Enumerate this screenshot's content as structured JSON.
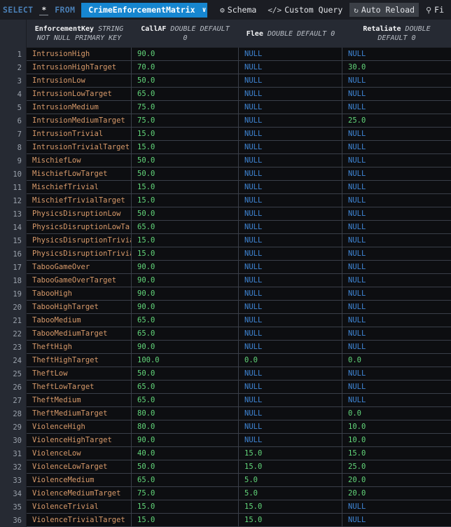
{
  "toolbar": {
    "select_keyword": "SELECT",
    "star": "*",
    "from_keyword": "FROM",
    "table_name": "CrimeEnforcementMatrix",
    "chevron": "∨",
    "schema_icon": "⚙",
    "schema_label": "Schema",
    "custom_query_icon": "</>",
    "custom_query_label": "Custom Query",
    "auto_reload_icon": "↻",
    "auto_reload_label": "Auto Reload",
    "find_icon": "⚲",
    "find_label": "Fi",
    "accent_blue": "#1686d0",
    "keyword_blue": "#4a7fb5",
    "button_fill": "#3b3f46"
  },
  "grid": {
    "columns": [
      {
        "name": "EnforcementKey",
        "type_line1": "STRING",
        "type_line2": "NOT NULL PRIMARY KEY"
      },
      {
        "name": "CallAF",
        "type_line1": "DOUBLE DEFAULT",
        "type_line2": "0"
      },
      {
        "name": "Flee",
        "type_line1": "DOUBLE DEFAULT 0",
        "type_line2": ""
      },
      {
        "name": "Retaliate",
        "type_line1": "DOUBLE",
        "type_line2": "DEFAULT 0"
      }
    ],
    "null_text": "NULL",
    "key_color": "#d89a6a",
    "number_color": "#62d67a",
    "null_color": "#3f86d6",
    "rows": [
      {
        "n": "1",
        "key": "IntrusionHigh",
        "callaf": "90.0",
        "flee": "NULL",
        "retaliate": "NULL"
      },
      {
        "n": "2",
        "key": "IntrusionHighTarget",
        "callaf": "70.0",
        "flee": "NULL",
        "retaliate": "30.0"
      },
      {
        "n": "3",
        "key": "IntrusionLow",
        "callaf": "50.0",
        "flee": "NULL",
        "retaliate": "NULL"
      },
      {
        "n": "4",
        "key": "IntrusionLowTarget",
        "callaf": "65.0",
        "flee": "NULL",
        "retaliate": "NULL"
      },
      {
        "n": "5",
        "key": "IntrusionMedium",
        "callaf": "75.0",
        "flee": "NULL",
        "retaliate": "NULL"
      },
      {
        "n": "6",
        "key": "IntrusionMediumTarget",
        "callaf": "75.0",
        "flee": "NULL",
        "retaliate": "25.0"
      },
      {
        "n": "7",
        "key": "IntrusionTrivial",
        "callaf": "15.0",
        "flee": "NULL",
        "retaliate": "NULL"
      },
      {
        "n": "8",
        "key": "IntrusionTrivialTarget",
        "callaf": "15.0",
        "flee": "NULL",
        "retaliate": "NULL"
      },
      {
        "n": "9",
        "key": "MischiefLow",
        "callaf": "50.0",
        "flee": "NULL",
        "retaliate": "NULL"
      },
      {
        "n": "10",
        "key": "MischiefLowTarget",
        "callaf": "50.0",
        "flee": "NULL",
        "retaliate": "NULL"
      },
      {
        "n": "11",
        "key": "MischiefTrivial",
        "callaf": "15.0",
        "flee": "NULL",
        "retaliate": "NULL"
      },
      {
        "n": "12",
        "key": "MischiefTrivialTarget",
        "callaf": "15.0",
        "flee": "NULL",
        "retaliate": "NULL"
      },
      {
        "n": "13",
        "key": "PhysicsDisruptionLow",
        "callaf": "50.0",
        "flee": "NULL",
        "retaliate": "NULL"
      },
      {
        "n": "14",
        "key": "PhysicsDisruptionLowTarget",
        "callaf": "65.0",
        "flee": "NULL",
        "retaliate": "NULL"
      },
      {
        "n": "15",
        "key": "PhysicsDisruptionTrivial",
        "callaf": "15.0",
        "flee": "NULL",
        "retaliate": "NULL"
      },
      {
        "n": "16",
        "key": "PhysicsDisruptionTrivialTarget",
        "callaf": "15.0",
        "flee": "NULL",
        "retaliate": "NULL"
      },
      {
        "n": "17",
        "key": "TabooGameOver",
        "callaf": "90.0",
        "flee": "NULL",
        "retaliate": "NULL"
      },
      {
        "n": "18",
        "key": "TabooGameOverTarget",
        "callaf": "90.0",
        "flee": "NULL",
        "retaliate": "NULL"
      },
      {
        "n": "19",
        "key": "TabooHigh",
        "callaf": "90.0",
        "flee": "NULL",
        "retaliate": "NULL"
      },
      {
        "n": "20",
        "key": "TabooHighTarget",
        "callaf": "90.0",
        "flee": "NULL",
        "retaliate": "NULL"
      },
      {
        "n": "21",
        "key": "TabooMedium",
        "callaf": "65.0",
        "flee": "NULL",
        "retaliate": "NULL"
      },
      {
        "n": "22",
        "key": "TabooMediumTarget",
        "callaf": "65.0",
        "flee": "NULL",
        "retaliate": "NULL"
      },
      {
        "n": "23",
        "key": "TheftHigh",
        "callaf": "90.0",
        "flee": "NULL",
        "retaliate": "NULL"
      },
      {
        "n": "24",
        "key": "TheftHighTarget",
        "callaf": "100.0",
        "flee": "0.0",
        "retaliate": "0.0"
      },
      {
        "n": "25",
        "key": "TheftLow",
        "callaf": "50.0",
        "flee": "NULL",
        "retaliate": "NULL"
      },
      {
        "n": "26",
        "key": "TheftLowTarget",
        "callaf": "65.0",
        "flee": "NULL",
        "retaliate": "NULL"
      },
      {
        "n": "27",
        "key": "TheftMedium",
        "callaf": "65.0",
        "flee": "NULL",
        "retaliate": "NULL"
      },
      {
        "n": "28",
        "key": "TheftMediumTarget",
        "callaf": "80.0",
        "flee": "NULL",
        "retaliate": "0.0"
      },
      {
        "n": "29",
        "key": "ViolenceHigh",
        "callaf": "80.0",
        "flee": "NULL",
        "retaliate": "10.0"
      },
      {
        "n": "30",
        "key": "ViolenceHighTarget",
        "callaf": "90.0",
        "flee": "NULL",
        "retaliate": "10.0"
      },
      {
        "n": "31",
        "key": "ViolenceLow",
        "callaf": "40.0",
        "flee": "15.0",
        "retaliate": "15.0"
      },
      {
        "n": "32",
        "key": "ViolenceLowTarget",
        "callaf": "50.0",
        "flee": "15.0",
        "retaliate": "25.0"
      },
      {
        "n": "33",
        "key": "ViolenceMedium",
        "callaf": "65.0",
        "flee": "5.0",
        "retaliate": "20.0"
      },
      {
        "n": "34",
        "key": "ViolenceMediumTarget",
        "callaf": "75.0",
        "flee": "5.0",
        "retaliate": "20.0"
      },
      {
        "n": "35",
        "key": "ViolenceTrivial",
        "callaf": "15.0",
        "flee": "15.0",
        "retaliate": "NULL"
      },
      {
        "n": "36",
        "key": "ViolenceTrivialTarget",
        "callaf": "15.0",
        "flee": "15.0",
        "retaliate": "NULL"
      }
    ]
  }
}
